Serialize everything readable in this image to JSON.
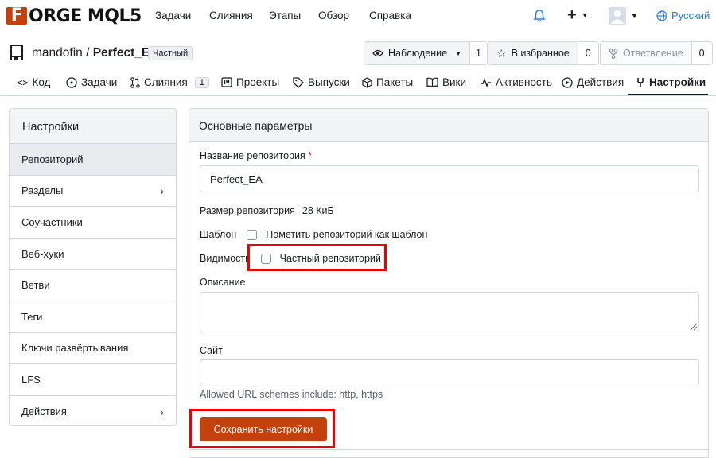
{
  "nav": {
    "logo_text": "ORGE MQL5",
    "items": [
      "Задачи",
      "Слияния",
      "Этапы",
      "Обзор",
      "Справка"
    ],
    "language": "Русский",
    "icons": [
      "bell-icon",
      "plus-icon",
      "avatar",
      "globe-icon"
    ]
  },
  "repo": {
    "owner": "mandofin",
    "name": "Perfect_EA",
    "badge": "Частный",
    "watch_label": "Наблюдение",
    "watch_count": "1",
    "star_label": "В избранное",
    "star_count": "0",
    "fork_label": "Ответвление",
    "fork_count": "0"
  },
  "tabs": [
    {
      "label": "Код",
      "icon": "code-icon"
    },
    {
      "label": "Задачи",
      "icon": "issue-icon"
    },
    {
      "label": "Слияния",
      "icon": "pull-request-icon",
      "count": "1"
    },
    {
      "label": "Проекты",
      "icon": "project-icon"
    },
    {
      "label": "Выпуски",
      "icon": "tag-icon"
    },
    {
      "label": "Пакеты",
      "icon": "package-icon"
    },
    {
      "label": "Вики",
      "icon": "book-icon"
    },
    {
      "label": "Активность",
      "icon": "pulse-icon"
    },
    {
      "label": "Действия",
      "icon": "play-icon"
    },
    {
      "label": "Настройки",
      "icon": "tools-icon",
      "active": true
    }
  ],
  "sidebar": {
    "title": "Настройки",
    "items": [
      {
        "label": "Репозиторий",
        "active": true
      },
      {
        "label": "Разделы",
        "chevron": true
      },
      {
        "label": "Соучастники"
      },
      {
        "label": "Веб-хуки"
      },
      {
        "label": "Ветви"
      },
      {
        "label": "Теги"
      },
      {
        "label": "Ключи развёртывания"
      },
      {
        "label": "LFS"
      },
      {
        "label": "Действия",
        "chevron": true
      }
    ]
  },
  "form": {
    "section_title": "Основные параметры",
    "repo_name_label": "Название репозитория",
    "required_mark": "*",
    "repo_name_value": "Perfect_EA",
    "repo_size_label": "Размер репозитория",
    "repo_size_value": "28 КиБ",
    "template_label": "Шаблон",
    "template_checkbox_label": "Пометить репозиторий как шаблон",
    "template_checked": false,
    "visibility_label": "Видимость",
    "visibility_checkbox_label": "Частный репозиторий",
    "visibility_checked": false,
    "description_label": "Описание",
    "description_value": "",
    "website_label": "Сайт",
    "website_value": "",
    "url_hint": "Allowed URL schemes include: http, https",
    "save_label": "Сохранить настройки"
  },
  "colors": {
    "accent": "#c2410c",
    "link": "#2a7ae2",
    "highlight": "#e00000"
  }
}
